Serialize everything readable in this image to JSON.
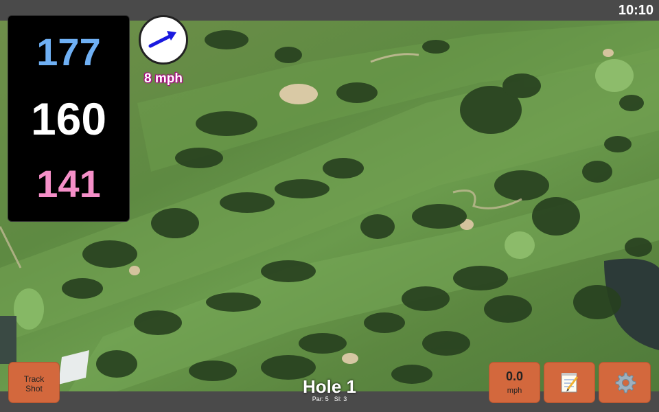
{
  "status": {
    "clock": "10:10"
  },
  "distances": {
    "back": "177",
    "middle": "160",
    "front": "141"
  },
  "wind": {
    "speed_label": "8 mph",
    "direction_icon": "wind-arrow-icon"
  },
  "hole": {
    "title": "Hole 1",
    "par": "Par: 5",
    "stroke_index": "SI: 3"
  },
  "buttons": {
    "track_shot": "Track\nShot",
    "wind_value": "0.0",
    "wind_unit": "mph",
    "notes_icon": "notepad-icon",
    "settings_icon": "gear-icon"
  },
  "colors": {
    "back": "#6fb0f4",
    "middle": "#ffffff",
    "front": "#f58fc8",
    "button": "#d3683d",
    "wind_label_glow": "#b0008a"
  }
}
